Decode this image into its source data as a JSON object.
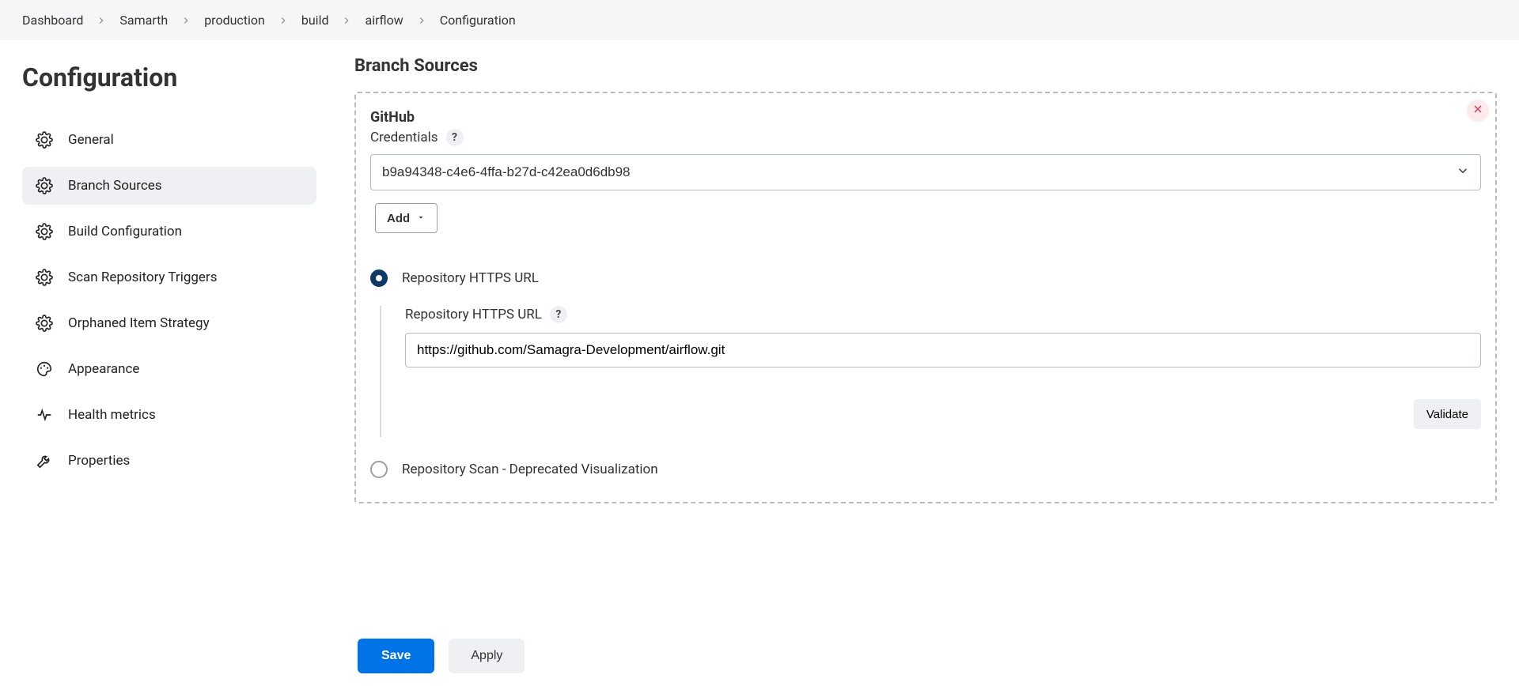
{
  "breadcrumb": [
    "Dashboard",
    "Samarth",
    "production",
    "build",
    "airflow",
    "Configuration"
  ],
  "page": {
    "title": "Configuration"
  },
  "sidebar": {
    "items": [
      {
        "label": "General",
        "icon": "gear-icon",
        "active": false
      },
      {
        "label": "Branch Sources",
        "icon": "gear-icon",
        "active": true
      },
      {
        "label": "Build Configuration",
        "icon": "gear-icon",
        "active": false
      },
      {
        "label": "Scan Repository Triggers",
        "icon": "gear-icon",
        "active": false
      },
      {
        "label": "Orphaned Item Strategy",
        "icon": "gear-icon",
        "active": false
      },
      {
        "label": "Appearance",
        "icon": "palette-icon",
        "active": false
      },
      {
        "label": "Health metrics",
        "icon": "heartbeat-icon",
        "active": false
      },
      {
        "label": "Properties",
        "icon": "wrench-icon",
        "active": false
      }
    ]
  },
  "section": {
    "title": "Branch Sources"
  },
  "github": {
    "heading": "GitHub",
    "credentials_label": "Credentials",
    "credentials_value": "b9a94348-c4e6-4ffa-b27d-c42ea0d6db98",
    "add_label": "Add",
    "options": {
      "repo_https": {
        "label": "Repository HTTPS URL",
        "selected": true,
        "url_label": "Repository HTTPS URL",
        "url_value": "https://github.com/Samagra-Development/airflow.git",
        "validate_label": "Validate"
      },
      "repo_scan": {
        "label": "Repository Scan - Deprecated Visualization",
        "selected": false
      }
    }
  },
  "footer": {
    "save_label": "Save",
    "apply_label": "Apply"
  },
  "help": "?"
}
